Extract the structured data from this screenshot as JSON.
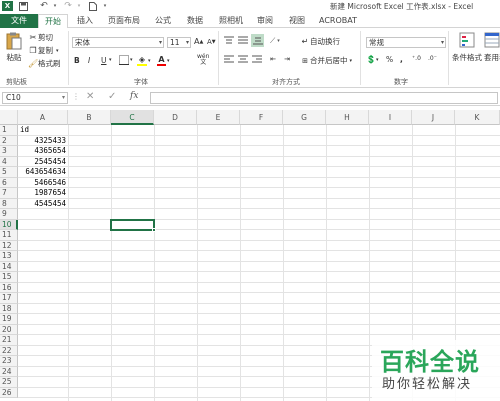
{
  "title_bar": {
    "title": "新建 Microsoft Excel 工作表.xlsx - Excel"
  },
  "tabs": [
    {
      "label": "文件"
    },
    {
      "label": "开始"
    },
    {
      "label": "插入"
    },
    {
      "label": "页面布局"
    },
    {
      "label": "公式"
    },
    {
      "label": "数据"
    },
    {
      "label": "照相机"
    },
    {
      "label": "审阅"
    },
    {
      "label": "视图"
    },
    {
      "label": "ACROBAT"
    }
  ],
  "ribbon": {
    "clipboard": {
      "paste": "粘贴",
      "cut": "剪切",
      "copy": "复制",
      "format_painter": "格式刷",
      "group": "剪贴板"
    },
    "font": {
      "name": "宋体",
      "size": "11",
      "bold": "B",
      "italic": "I",
      "underline": "U",
      "group": "字体"
    },
    "alignment": {
      "wrap": "自动换行",
      "merge": "合并后居中",
      "group": "对齐方式"
    },
    "number": {
      "format": "常规",
      "group": "数字"
    },
    "styles": {
      "conditional": "条件格式",
      "table_format": "套用表格格式"
    }
  },
  "formula_bar": {
    "name_box": "C10",
    "fx": "fx",
    "content": ""
  },
  "columns": [
    "A",
    "B",
    "C",
    "D",
    "E",
    "F",
    "G",
    "H",
    "I",
    "J",
    "K"
  ],
  "rows": [
    "1",
    "2",
    "3",
    "4",
    "5",
    "6",
    "7",
    "8",
    "9",
    "10",
    "11",
    "12",
    "13",
    "14",
    "15",
    "16",
    "17",
    "18",
    "19",
    "20",
    "21",
    "22",
    "23",
    "24",
    "25",
    "26"
  ],
  "cells": {
    "A1": "id",
    "A2": "4325433",
    "A3": "4365654",
    "A4": "2545454",
    "A5": "643654634",
    "A6": "5466546",
    "A7": "1987654",
    "A8": "4545454"
  },
  "watermark": {
    "top": "百科全说",
    "bottom": "助你轻松解决"
  }
}
